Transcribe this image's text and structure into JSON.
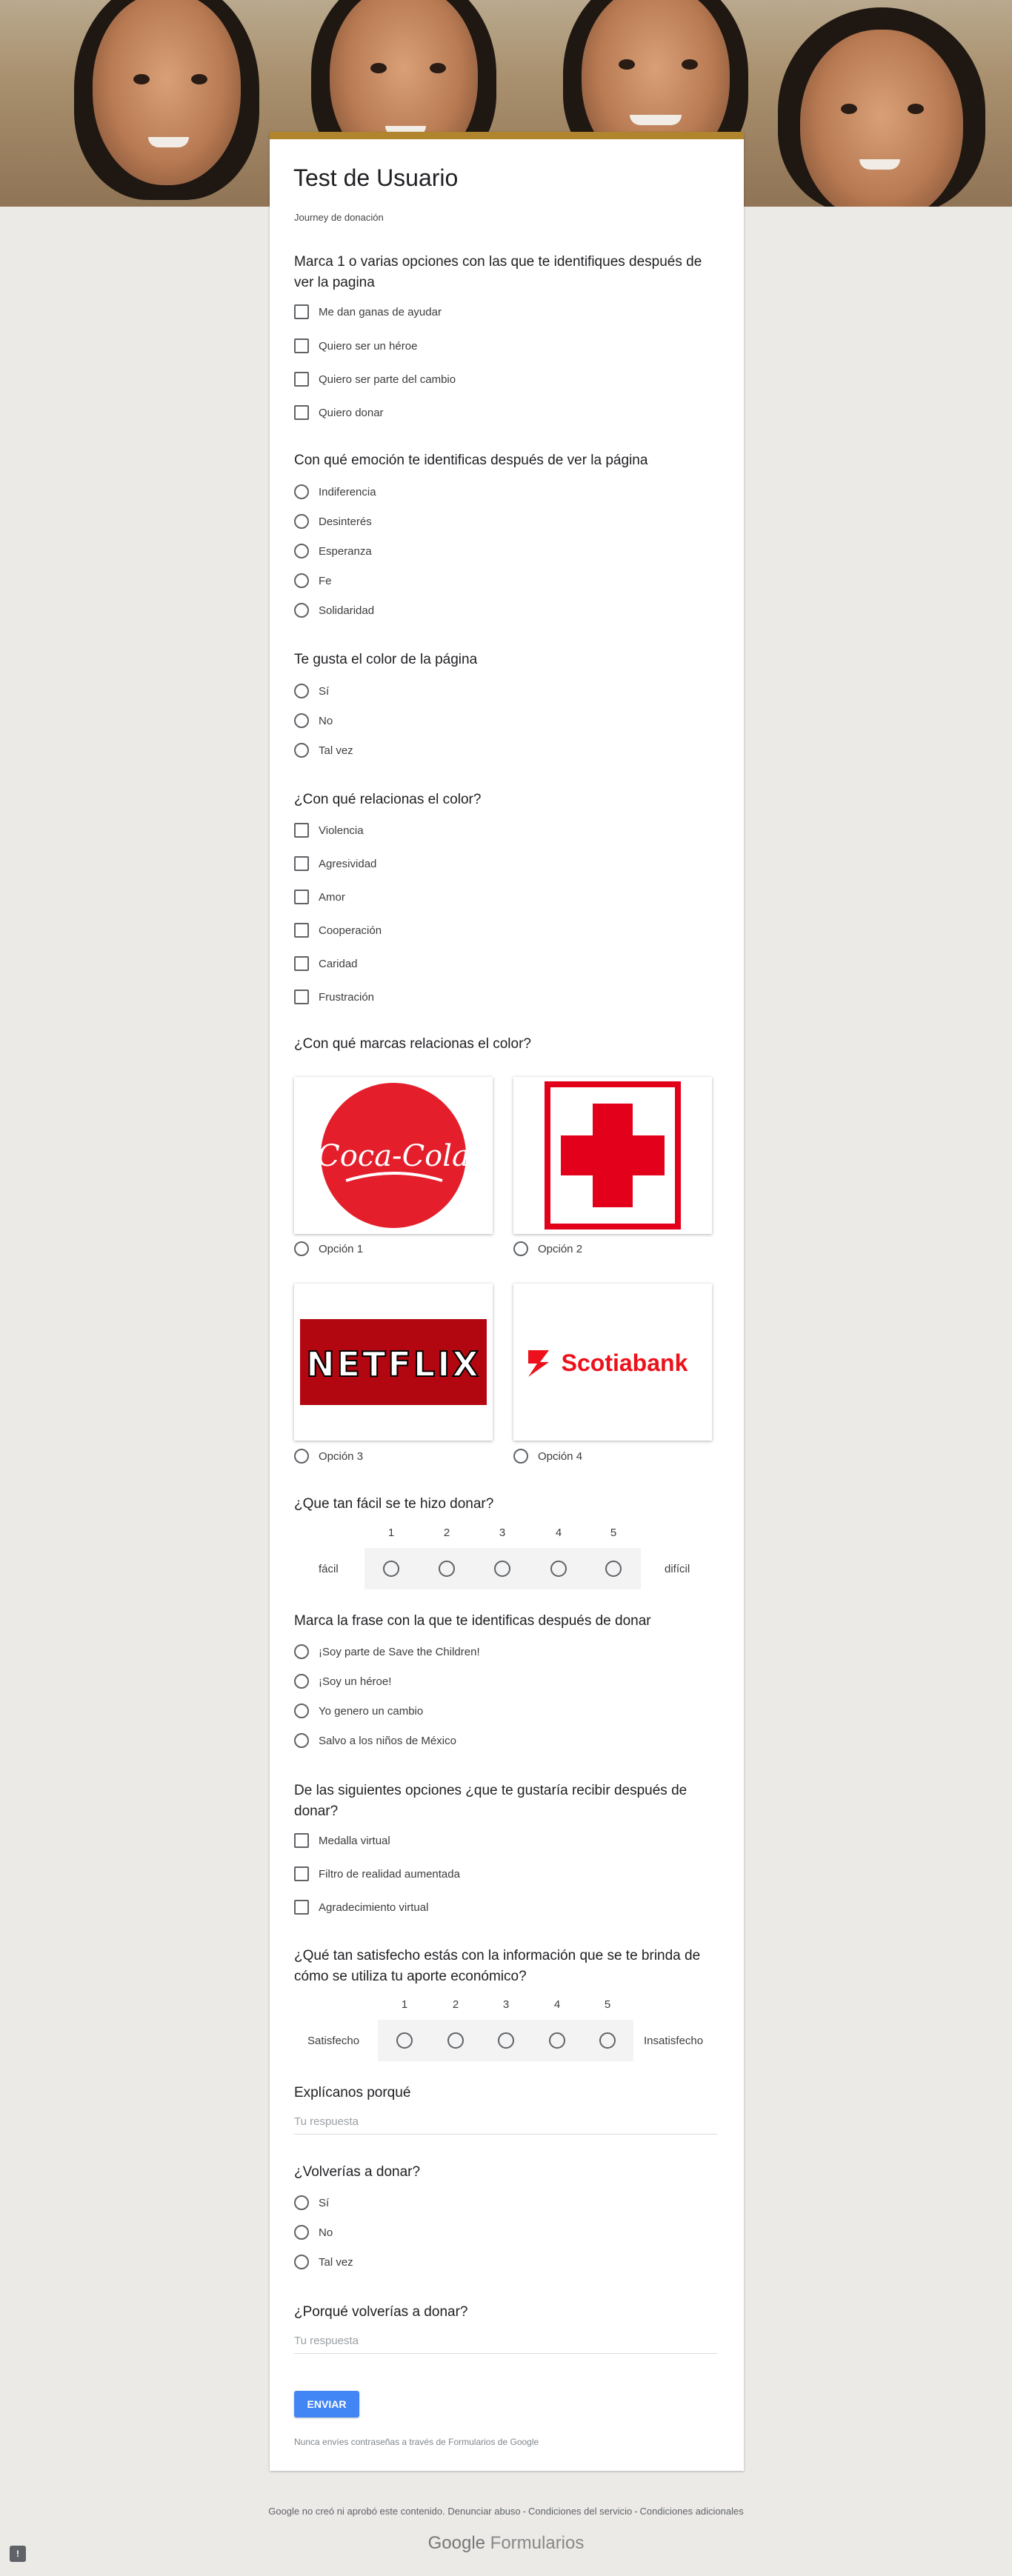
{
  "form": {
    "title": "Test de Usuario",
    "description": "Journey de donación",
    "accent_color": "#b0852e"
  },
  "q1": {
    "title": "Marca 1 o varias opciones con las que te identifiques después de ver la pagina",
    "options": [
      "Me dan ganas de ayudar",
      "Quiero ser un héroe",
      "Quiero ser parte del cambio",
      "Quiero donar"
    ]
  },
  "q2": {
    "title": "Con qué emoción te identificas después de ver la página",
    "options": [
      "Indiferencia",
      "Desinterés",
      "Esperanza",
      "Fe",
      "Solidaridad"
    ]
  },
  "q3": {
    "title": "Te gusta el color de la página",
    "options": [
      "Sí",
      "No",
      "Tal vez"
    ]
  },
  "q4": {
    "title": "¿Con qué relacionas el color?",
    "options": [
      "Violencia",
      "Agresividad",
      "Amor",
      "Cooperación",
      "Caridad",
      "Frustración"
    ]
  },
  "q5": {
    "title": "¿Con qué marcas relacionas el color?",
    "options": [
      {
        "label": "Opción 1",
        "image": "coca-cola-logo",
        "logo_text": "Coca-Cola"
      },
      {
        "label": "Opción 2",
        "image": "red-cross-logo"
      },
      {
        "label": "Opción 3",
        "image": "netflix-logo",
        "logo_text": "NETFLIX"
      },
      {
        "label": "Opción 4",
        "image": "scotiabank-logo",
        "logo_text": "Scotiabank"
      }
    ]
  },
  "q6": {
    "title": "¿Que tan fácil se te hizo donar?",
    "scale": [
      "1",
      "2",
      "3",
      "4",
      "5"
    ],
    "min_label": "fácil",
    "max_label": "difícil"
  },
  "q7": {
    "title": "Marca la frase con la que te identificas después de donar",
    "options": [
      "¡Soy parte de Save the Children!",
      "¡Soy un héroe!",
      "Yo genero un cambio",
      "Salvo a los niños de México"
    ]
  },
  "q8": {
    "title": "De las siguientes opciones ¿que te gustaría recibir después de donar?",
    "options": [
      "Medalla virtual",
      "Filtro de realidad aumentada",
      "Agradecimiento virtual"
    ]
  },
  "q9": {
    "title": "¿Qué tan satisfecho estás con la información que se te brinda de cómo se utiliza tu aporte económico?",
    "scale": [
      "1",
      "2",
      "3",
      "4",
      "5"
    ],
    "min_label": "Satisfecho",
    "max_label": "Insatisfecho"
  },
  "q10": {
    "title": "Explícanos porqué",
    "placeholder": "Tu respuesta"
  },
  "q11": {
    "title": "¿Volverías a donar?",
    "options": [
      "Sí",
      "No",
      "Tal vez"
    ]
  },
  "q12": {
    "title": "¿Porqué volverías a donar?",
    "placeholder": "Tu respuesta"
  },
  "submit_label": "ENVIAR",
  "password_warning": "Nunca envíes contraseñas a través de Formularios de Google",
  "footer": {
    "disclaimer": "Google no creó ni aprobó este contenido.",
    "links": [
      "Denunciar abuso",
      "Condiciones del servicio",
      "Condiciones adicionales"
    ],
    "brand_google": "Google",
    "brand_product": "Formularios"
  },
  "icons": {
    "report": "report-problem-icon"
  }
}
